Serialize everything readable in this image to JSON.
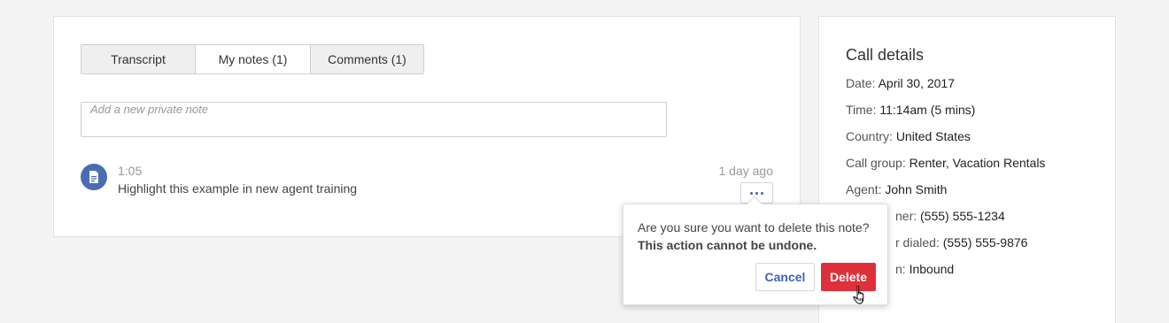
{
  "tabs": [
    {
      "label": "Transcript"
    },
    {
      "label": "My notes (1)"
    },
    {
      "label": "Comments (1)"
    }
  ],
  "note_input": {
    "placeholder": "Add a new private note"
  },
  "note": {
    "icon": "document-icon",
    "time": "1:05",
    "text": "Highlight this example in new agent training",
    "ago": "1 day ago"
  },
  "popover": {
    "question": "Are you sure you want to delete this note?",
    "warning": "This action cannot be undone.",
    "cancel_label": "Cancel",
    "delete_label": "Delete"
  },
  "call_details": {
    "title": "Call details",
    "rows": [
      {
        "label": "Date:",
        "value": "April 30, 2017"
      },
      {
        "label": "Time:",
        "value": "11:14am (5 mins)"
      },
      {
        "label": "Country:",
        "value": "United States"
      },
      {
        "label": "Call group:",
        "value": "Renter, Vacation Rentals"
      },
      {
        "label": "Agent:",
        "value": "John Smith"
      },
      {
        "label": "ner:",
        "value": "(555) 555-1234"
      },
      {
        "label": "r dialed:",
        "value": "(555) 555-9876"
      },
      {
        "label": "n:",
        "value": "Inbound"
      }
    ]
  },
  "colors": {
    "accent": "#3e63b8",
    "avatar": "#4a6cb3",
    "danger": "#df2f3a"
  }
}
